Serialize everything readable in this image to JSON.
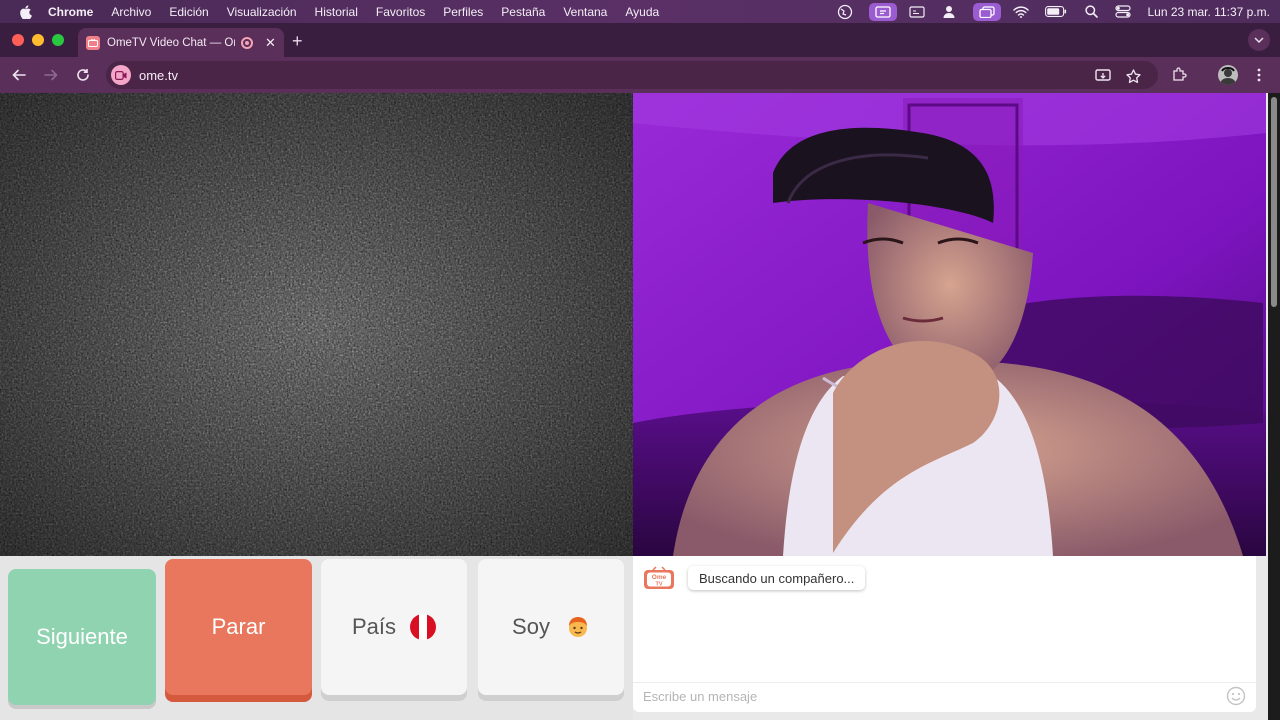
{
  "menubar": {
    "app_name": "Chrome",
    "items": [
      "Archivo",
      "Edición",
      "Visualización",
      "Historial",
      "Favoritos",
      "Perfiles",
      "Pestaña",
      "Ventana",
      "Ayuda"
    ],
    "clock": "Lun 23 mar.  11:37 p.m."
  },
  "browser": {
    "tab_title": "OmeTV Video Chat — Ome",
    "url": "ome.tv"
  },
  "controls": {
    "next_label": "Siguiente",
    "stop_label": "Parar",
    "country_label": "País",
    "gender_label": "Soy"
  },
  "chat": {
    "logo_text_top": "Ome",
    "logo_text_bottom": "TV",
    "status_message": "Buscando un compañero...",
    "input_placeholder": "Escribe un mensaje"
  },
  "colors": {
    "next_button": "#8fd3b1",
    "stop_button": "#e8775d",
    "browser_frame": "#5a2f5a",
    "remote_video_light": "#8a1fd1"
  }
}
